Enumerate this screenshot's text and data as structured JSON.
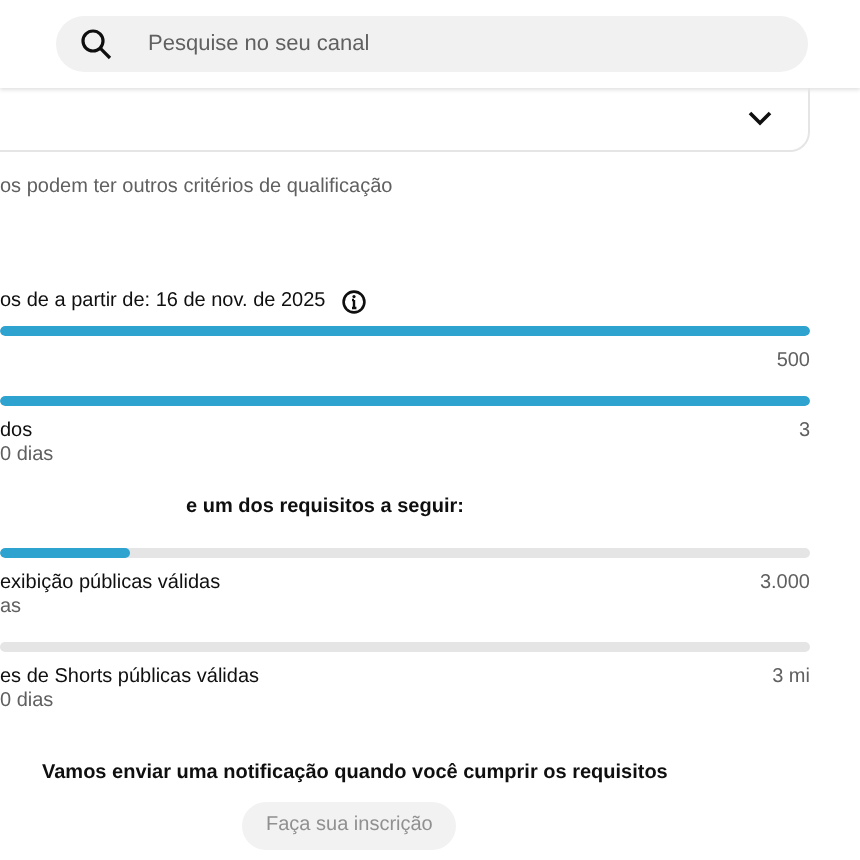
{
  "search": {
    "placeholder": "Pesquise no seu canal"
  },
  "card": {
    "expanded": false
  },
  "note": "os podem ter outros critérios de qualificação",
  "date_line": "os de a partir de: 16 de nov. de 2025",
  "requirements": [
    {
      "level": 1,
      "value": "500"
    },
    {
      "level": 1,
      "name": "dos",
      "sub": "0 dias",
      "value": "3"
    }
  ],
  "divider_text": "e um dos requisitos a seguir:",
  "alternatives": [
    {
      "level": 0.16,
      "name": "exibição públicas válidas",
      "sub": "as",
      "value": "3.000"
    },
    {
      "level": 0,
      "name": "es de Shorts públicas válidas",
      "sub": "0 dias",
      "value": "3 mi"
    }
  ],
  "notify_text": "Vamos enviar uma notificação quando você cumprir os requisitos",
  "button": {
    "label": "Faça sua inscrição",
    "disabled": true
  }
}
